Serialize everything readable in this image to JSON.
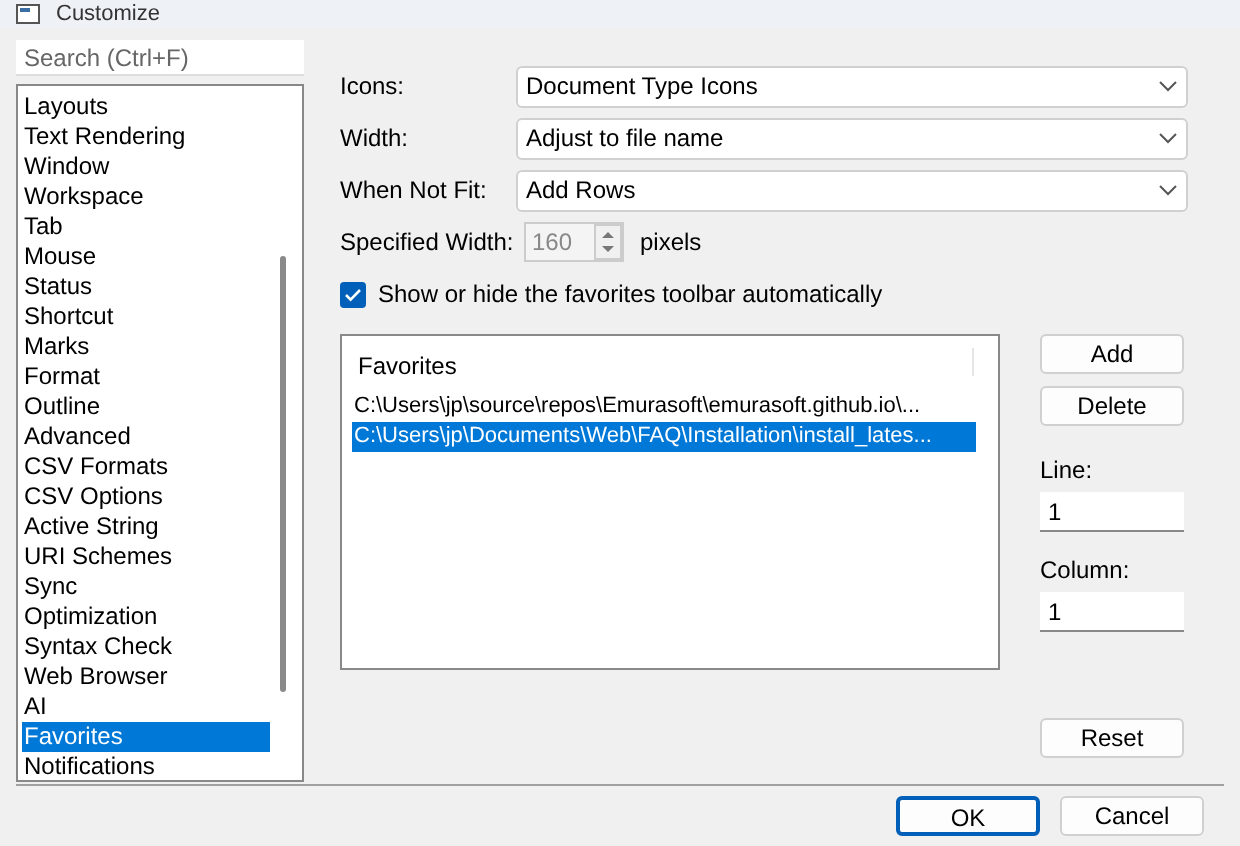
{
  "window": {
    "title": "Customize"
  },
  "search": {
    "placeholder": "Search (Ctrl+F)"
  },
  "categories": [
    {
      "label": "Layouts",
      "selected": false
    },
    {
      "label": "Text Rendering",
      "selected": false
    },
    {
      "label": "Window",
      "selected": false
    },
    {
      "label": "Workspace",
      "selected": false
    },
    {
      "label": "Tab",
      "selected": false
    },
    {
      "label": "Mouse",
      "selected": false
    },
    {
      "label": "Status",
      "selected": false
    },
    {
      "label": "Shortcut",
      "selected": false
    },
    {
      "label": "Marks",
      "selected": false
    },
    {
      "label": "Format",
      "selected": false
    },
    {
      "label": "Outline",
      "selected": false
    },
    {
      "label": "Advanced",
      "selected": false
    },
    {
      "label": "CSV Formats",
      "selected": false
    },
    {
      "label": "CSV Options",
      "selected": false
    },
    {
      "label": "Active String",
      "selected": false
    },
    {
      "label": "URI Schemes",
      "selected": false
    },
    {
      "label": "Sync",
      "selected": false
    },
    {
      "label": "Optimization",
      "selected": false
    },
    {
      "label": "Syntax Check",
      "selected": false
    },
    {
      "label": "Web Browser",
      "selected": false
    },
    {
      "label": "AI",
      "selected": false
    },
    {
      "label": "Favorites",
      "selected": true
    },
    {
      "label": "Notifications",
      "selected": false
    }
  ],
  "settings": [
    {
      "label": "Icons:",
      "value": "Document Type Icons"
    },
    {
      "label": "Width:",
      "value": "Adjust to file name"
    },
    {
      "label": "When Not Fit:",
      "value": "Add Rows"
    }
  ],
  "specified_width": {
    "label": "Specified Width:",
    "value": "160",
    "unit": "pixels",
    "disabled": true
  },
  "auto_toolbar": {
    "label": "Show or hide the favorites toolbar automatically",
    "checked": true
  },
  "favorites": {
    "header": "Favorites",
    "rows": [
      {
        "path": "C:\\Users\\jp\\source\\repos\\Emurasoft\\emurasoft.github.io\\...",
        "selected": false
      },
      {
        "path": "C:\\Users\\jp\\Documents\\Web\\FAQ\\Installation\\install_lates...",
        "selected": true
      }
    ]
  },
  "side_buttons": [
    "Add",
    "Delete"
  ],
  "line": {
    "label": "Line:",
    "value": "1"
  },
  "column": {
    "label": "Column:",
    "value": "1"
  },
  "reset_button": "Reset",
  "dialog_buttons": [
    {
      "label": "OK",
      "default": true
    },
    {
      "label": "Cancel",
      "default": false
    }
  ]
}
